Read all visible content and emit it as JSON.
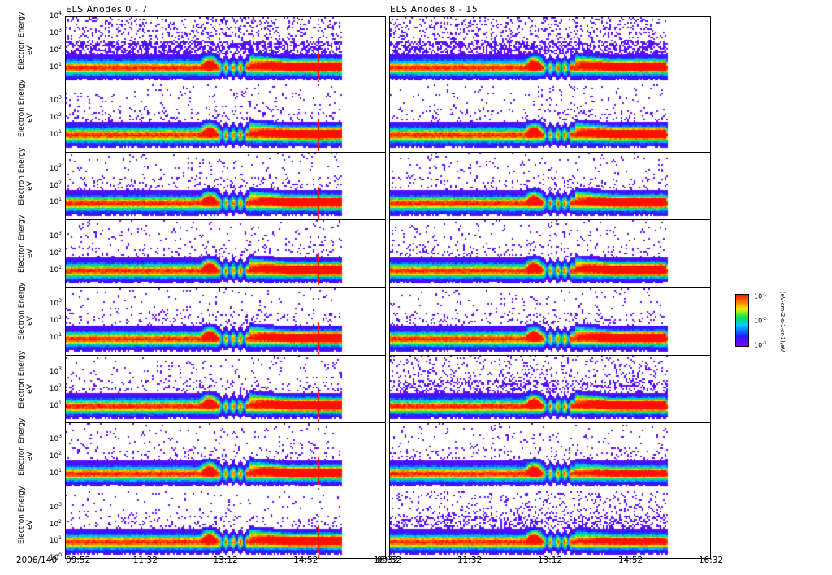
{
  "chart_data": {
    "type": "heatmap",
    "titles": [
      "ELS Anodes 0 - 7",
      "ELS Anodes 8 - 15"
    ],
    "ylabel": [
      "Electron Energy",
      "eV"
    ],
    "yscale": "log",
    "ylim": [
      1,
      10000
    ],
    "y_ticks_top": [
      "10",
      "10",
      "10",
      "10"
    ],
    "y_tick_exps_top": [
      "4",
      "3",
      "2",
      "1"
    ],
    "y_ticks": [
      "10",
      "10",
      "10"
    ],
    "y_tick_exps": [
      "3",
      "2",
      "1"
    ],
    "y_tick_bottom_exp": "0",
    "x_date_label": "2006/140",
    "x_ticks": [
      "09:52",
      "11:32",
      "13:12",
      "14:52",
      "16:32"
    ],
    "xlim_minutes": [
      0,
      400
    ],
    "data_end_minute": 346,
    "features": {
      "core_band_logE": 1.0,
      "heating_event_minutes": [
        168,
        190
      ],
      "dropout_minutes": [
        190,
        225
      ],
      "hot_band_minutes": [
        230,
        345
      ],
      "spike_minutes": [
        314,
        322
      ]
    },
    "panels_per_column": 8,
    "colorbar": {
      "tick_base": [
        "10",
        "10",
        "10"
      ],
      "tick_exps": [
        "-1",
        "-2",
        "-3"
      ],
      "unit": "(eV-cm-2-s-1-sr-1)/eV"
    }
  }
}
